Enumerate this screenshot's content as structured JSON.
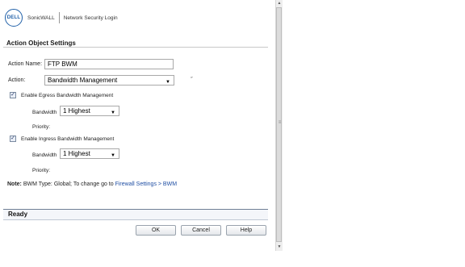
{
  "header": {
    "logo_text": "DELL",
    "brand": "SonicWALL",
    "title": "Network Security Login"
  },
  "section": {
    "title": "Action Object Settings"
  },
  "form": {
    "action_name_label": "Action Name:",
    "action_name_value": "FTP BWM",
    "action_label": "Action:",
    "action_value": "Bandwidth Management",
    "egress": {
      "enabled": true,
      "label": "Enable Egress Bandwidth Management",
      "bandwidth_label": "Bandwidth",
      "bandwidth_value": "1 Highest",
      "priority_label": "Priority:"
    },
    "ingress": {
      "enabled": true,
      "label": "Enable Ingress Bandwidth Management",
      "bandwidth_label": "Bandwidth",
      "bandwidth_value": "1 Highest",
      "priority_label": "Priority:"
    }
  },
  "note": {
    "prefix": "Note:",
    "text": " BWM Type: Global; To change go to ",
    "link": "Firewall Settings > BWM"
  },
  "status": {
    "text": "Ready"
  },
  "buttons": {
    "ok": "OK",
    "cancel": "Cancel",
    "help": "Help"
  },
  "icons": {
    "checkbox_checked": "check-icon",
    "dropdown": "chevron-down-icon"
  }
}
